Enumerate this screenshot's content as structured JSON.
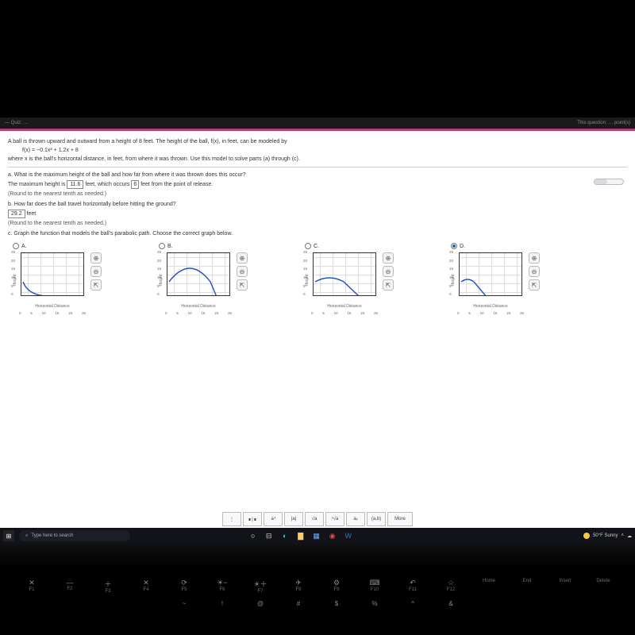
{
  "titlebar": {
    "left": "— Quiz: …",
    "right": "This question: … point(s)"
  },
  "problem": {
    "intro": "A ball is thrown upward and outward from a height of 8 feet. The height of the ball, f(x), in feet, can be modeled by",
    "equation": "f(x) = −0.1x² + 1.2x + 8",
    "intro2": "where x is the ball's horizontal distance, in feet, from where it was thrown. Use this model to solve parts (a) through (c)."
  },
  "a": {
    "q": "a. What is the maximum height of the ball and how far from where it was thrown does this occur?",
    "ans_pre": "The maximum height is ",
    "val1": "11.6",
    "mid": " feet, which occurs ",
    "val2": "6",
    "post": " feet from the point of release.",
    "note": "(Round to the nearest tenth as needed.)"
  },
  "b": {
    "q": "b. How far does the ball travel horizontally before hitting the ground?",
    "val": "29.2",
    "unit": " feet",
    "note": "(Round to the nearest tenth as needed.)"
  },
  "c": {
    "q": "c. Graph the function that models the ball's parabolic path. Choose the correct graph below."
  },
  "options": {
    "labels": [
      "A.",
      "B.",
      "C.",
      "D."
    ],
    "selected": 3,
    "ylabel": "Height",
    "xlabel": "Horizontal Distance",
    "ticks_y": [
      "25",
      "20",
      "15",
      "10",
      "5",
      "0"
    ],
    "ticks_x": [
      "0",
      "5",
      "10",
      "15",
      "20",
      "25"
    ]
  },
  "palette": [
    "⋮",
    "∎∣∎",
    "a ͯ",
    "|a|",
    "√a",
    "ⁿ√a",
    "aₓ",
    "(a,b)",
    "More"
  ],
  "chart_data": [
    {
      "type": "line",
      "option": "A",
      "title": "",
      "xlabel": "Horizontal Distance",
      "ylabel": "Height",
      "xlim": [
        0,
        25
      ],
      "ylim": [
        0,
        25
      ],
      "points": [
        [
          0,
          8
        ],
        [
          2,
          4
        ],
        [
          4,
          2
        ],
        [
          6,
          1
        ],
        [
          8,
          0.5
        ],
        [
          10,
          0.3
        ],
        [
          20,
          0.1
        ],
        [
          25,
          0.05
        ]
      ]
    },
    {
      "type": "line",
      "option": "B",
      "title": "",
      "xlabel": "Horizontal Distance",
      "ylabel": "Height",
      "xlim": [
        0,
        25
      ],
      "ylim": [
        0,
        25
      ],
      "points": [
        [
          0,
          8
        ],
        [
          3,
          13
        ],
        [
          6,
          16
        ],
        [
          9,
          17
        ],
        [
          12,
          16
        ],
        [
          15,
          13
        ],
        [
          18,
          8
        ],
        [
          20,
          3
        ],
        [
          21,
          0
        ]
      ]
    },
    {
      "type": "line",
      "option": "C",
      "title": "",
      "xlabel": "Horizontal Distance",
      "ylabel": "Height",
      "xlim": [
        0,
        25
      ],
      "ylim": [
        0,
        25
      ],
      "points": [
        [
          0,
          8
        ],
        [
          3,
          10.5
        ],
        [
          6,
          11.6
        ],
        [
          9,
          11.1
        ],
        [
          12,
          9.2
        ],
        [
          15,
          6.5
        ],
        [
          17,
          3.5
        ],
        [
          18.8,
          0
        ]
      ]
    },
    {
      "type": "line",
      "option": "D",
      "title": "",
      "xlabel": "Horizontal Distance",
      "ylabel": "Height",
      "xlim": [
        0,
        25
      ],
      "ylim": [
        0,
        25
      ],
      "points": [
        [
          0,
          8
        ],
        [
          2,
          9
        ],
        [
          4,
          8
        ],
        [
          6,
          6
        ],
        [
          8,
          3
        ],
        [
          10,
          0
        ]
      ]
    }
  ],
  "taskbar": {
    "search_placeholder": "Type here to search",
    "weather": "50°F Sunny"
  },
  "keys": {
    "fn": [
      {
        "sym": "✕",
        "lbl": "F1"
      },
      {
        "sym": "—",
        "lbl": "F2"
      },
      {
        "sym": "＋",
        "lbl": "F3"
      },
      {
        "sym": "✕",
        "lbl": "F4"
      },
      {
        "sym": "⟳",
        "lbl": "F5"
      },
      {
        "sym": "☀−",
        "lbl": "F6"
      },
      {
        "sym": "☀＋",
        "lbl": "F7"
      },
      {
        "sym": "✈",
        "lbl": "F8"
      },
      {
        "sym": "⚙",
        "lbl": "F9"
      },
      {
        "sym": "⌨",
        "lbl": "F10"
      },
      {
        "sym": "↶",
        "lbl": "F11"
      },
      {
        "sym": "☆",
        "lbl": "F12"
      },
      {
        "sym": "",
        "lbl": "Home"
      },
      {
        "sym": "",
        "lbl": "End"
      },
      {
        "sym": "",
        "lbl": "Insert"
      },
      {
        "sym": "",
        "lbl": "Delete"
      }
    ],
    "num": [
      "~",
      "!",
      "@",
      "#",
      "$",
      "%",
      "^",
      "&"
    ]
  }
}
